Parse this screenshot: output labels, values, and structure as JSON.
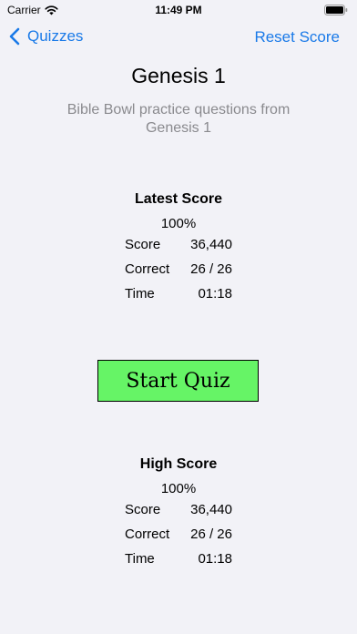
{
  "status_bar": {
    "carrier": "Carrier",
    "time": "11:49 PM"
  },
  "nav": {
    "back_label": "Quizzes",
    "reset_label": "Reset Score"
  },
  "quiz": {
    "title": "Genesis 1",
    "subtitle": "Bible Bowl practice questions from Genesis 1"
  },
  "latest_score": {
    "heading": "Latest Score",
    "percent": "100%",
    "rows": [
      {
        "label": "Score",
        "value": "36,440"
      },
      {
        "label": "Correct",
        "value": "26 / 26"
      },
      {
        "label": "Time",
        "value": "01:18"
      }
    ]
  },
  "start_button": {
    "label": "Start Quiz",
    "color": "#66f466"
  },
  "high_score": {
    "heading": "High Score",
    "percent": "100%",
    "rows": [
      {
        "label": "Score",
        "value": "36,440"
      },
      {
        "label": "Correct",
        "value": "26 / 26"
      },
      {
        "label": "Time",
        "value": "01:18"
      }
    ]
  },
  "colors": {
    "accent": "#1a7ae8",
    "background": "#f2f2f7",
    "subtitle": "#8a8a8e"
  },
  "icons": [
    "wifi-icon",
    "battery-icon",
    "chevron-left-icon"
  ]
}
